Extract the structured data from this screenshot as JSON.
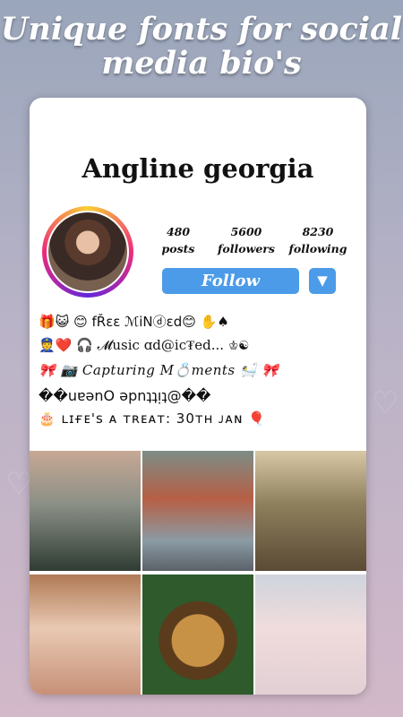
{
  "headline": {
    "line1": "Unique fonts for social",
    "line2": "media bio's"
  },
  "profile": {
    "username": "Angline georgia",
    "stats": [
      {
        "value": "480",
        "label": "posts"
      },
      {
        "value": "5600",
        "label": "followers"
      },
      {
        "value": "8230",
        "label": "following"
      }
    ],
    "follow_label": "Follow",
    "dropdown_icon": "▼"
  },
  "bio": {
    "line1": "🎁😺 😊 fŘɛɛ ℳiNⓓɛd😊 ✋♠",
    "line2": "👮❤️ 🎧 𝓜usic ɑd@ic₮ed... ♔☯",
    "line3": "🎀 📷 Capturing M💍ments 🛀 🎀",
    "line4": "��uɐǝnO ǝpnʇʇᴉʇ@��",
    "line5": "🎂 ʟɪғᴇ's ᴀ ᴛʀᴇᴀᴛ: 30ᴛʜ ᴊᴀɴ 🎈"
  },
  "posts": [
    {
      "icon": "bonsai-mug-photo"
    },
    {
      "icon": "woman-road-photo"
    },
    {
      "icon": "dining-room-photo"
    },
    {
      "icon": "girl-glasses-photo"
    },
    {
      "icon": "leopard-photo"
    },
    {
      "icon": "white-hair-girl-photo"
    }
  ],
  "colors": {
    "accent": "#4c9be8",
    "card": "#ffffff"
  }
}
